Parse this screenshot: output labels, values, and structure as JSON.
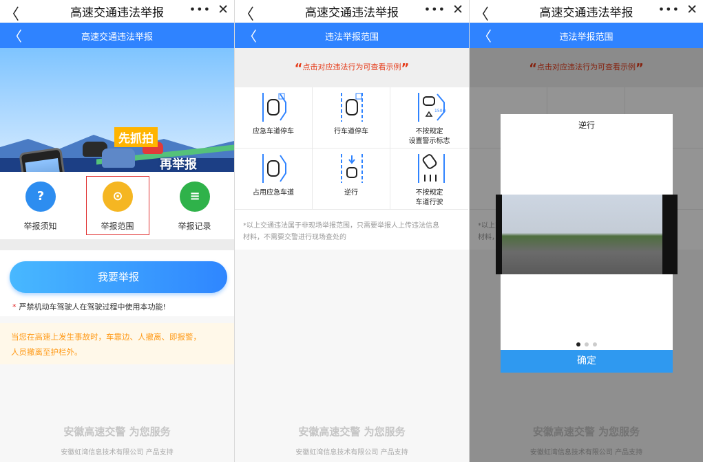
{
  "wechat": {
    "title": "高速交通违法举报",
    "back": "〈",
    "more": "•••",
    "close": "✕"
  },
  "panel1": {
    "header_title": "高速交通违法举报",
    "banner_tag1": "先抓拍",
    "banner_tag2": "再举报",
    "menu": [
      {
        "label": "举报须知",
        "icon": "question-icon",
        "symbol": "?",
        "color": "#2d8df0"
      },
      {
        "label": "举报范围",
        "icon": "location-pin-icon",
        "symbol": "⊙",
        "color": "#f5b622"
      },
      {
        "label": "举报记录",
        "icon": "document-icon",
        "symbol": "≡",
        "color": "#2fb24a"
      }
    ],
    "report_button": "我要举报",
    "warning_star": "*",
    "warning": "严禁机动车驾驶人在驾驶过程中使用本功能!",
    "tip_line1": "当您在高速上发生事故时，车靠边、人撤离、即报警，",
    "tip_line2": "人员撤离至护栏外。"
  },
  "panel2": {
    "header_title": "违法举报范围",
    "hint_open": "“",
    "hint": "点击对应违法行为可查看示例",
    "hint_close": "”",
    "items": [
      {
        "line1": "应急车道停车",
        "line2": "",
        "icon": "emergency-lane-parking-icon"
      },
      {
        "line1": "行车道停车",
        "line2": "",
        "icon": "lane-parking-icon"
      },
      {
        "line1": "不按规定",
        "line2": "设置警示标志",
        "icon": "warning-sign-icon",
        "distance": "150m"
      },
      {
        "line1": "占用应急车道",
        "line2": "",
        "icon": "occupy-emergency-lane-icon"
      },
      {
        "line1": "逆行",
        "line2": "",
        "icon": "wrong-way-icon"
      },
      {
        "line1": "不按规定",
        "line2": "车道行驶",
        "icon": "lane-violation-icon"
      }
    ],
    "note_line1": "*以上交通违法属于非现场举报范围，只需要举报人上传违法信息",
    "note_line2": "材料，不需要交警进行现场查处的"
  },
  "panel3": {
    "header_title": "违法举报范围",
    "modal_title": "逆行",
    "confirm": "确定",
    "carousel_pages": 3,
    "carousel_active": 1
  },
  "footer": {
    "line1": "安徽高速交警 为您服务",
    "line2": "安徽虹湾信息技术有限公司 产品支持"
  },
  "colors": {
    "primary_blue": "#2f83ff",
    "warning_red": "#e53a18",
    "tip_orange": "#ff9b1a"
  }
}
